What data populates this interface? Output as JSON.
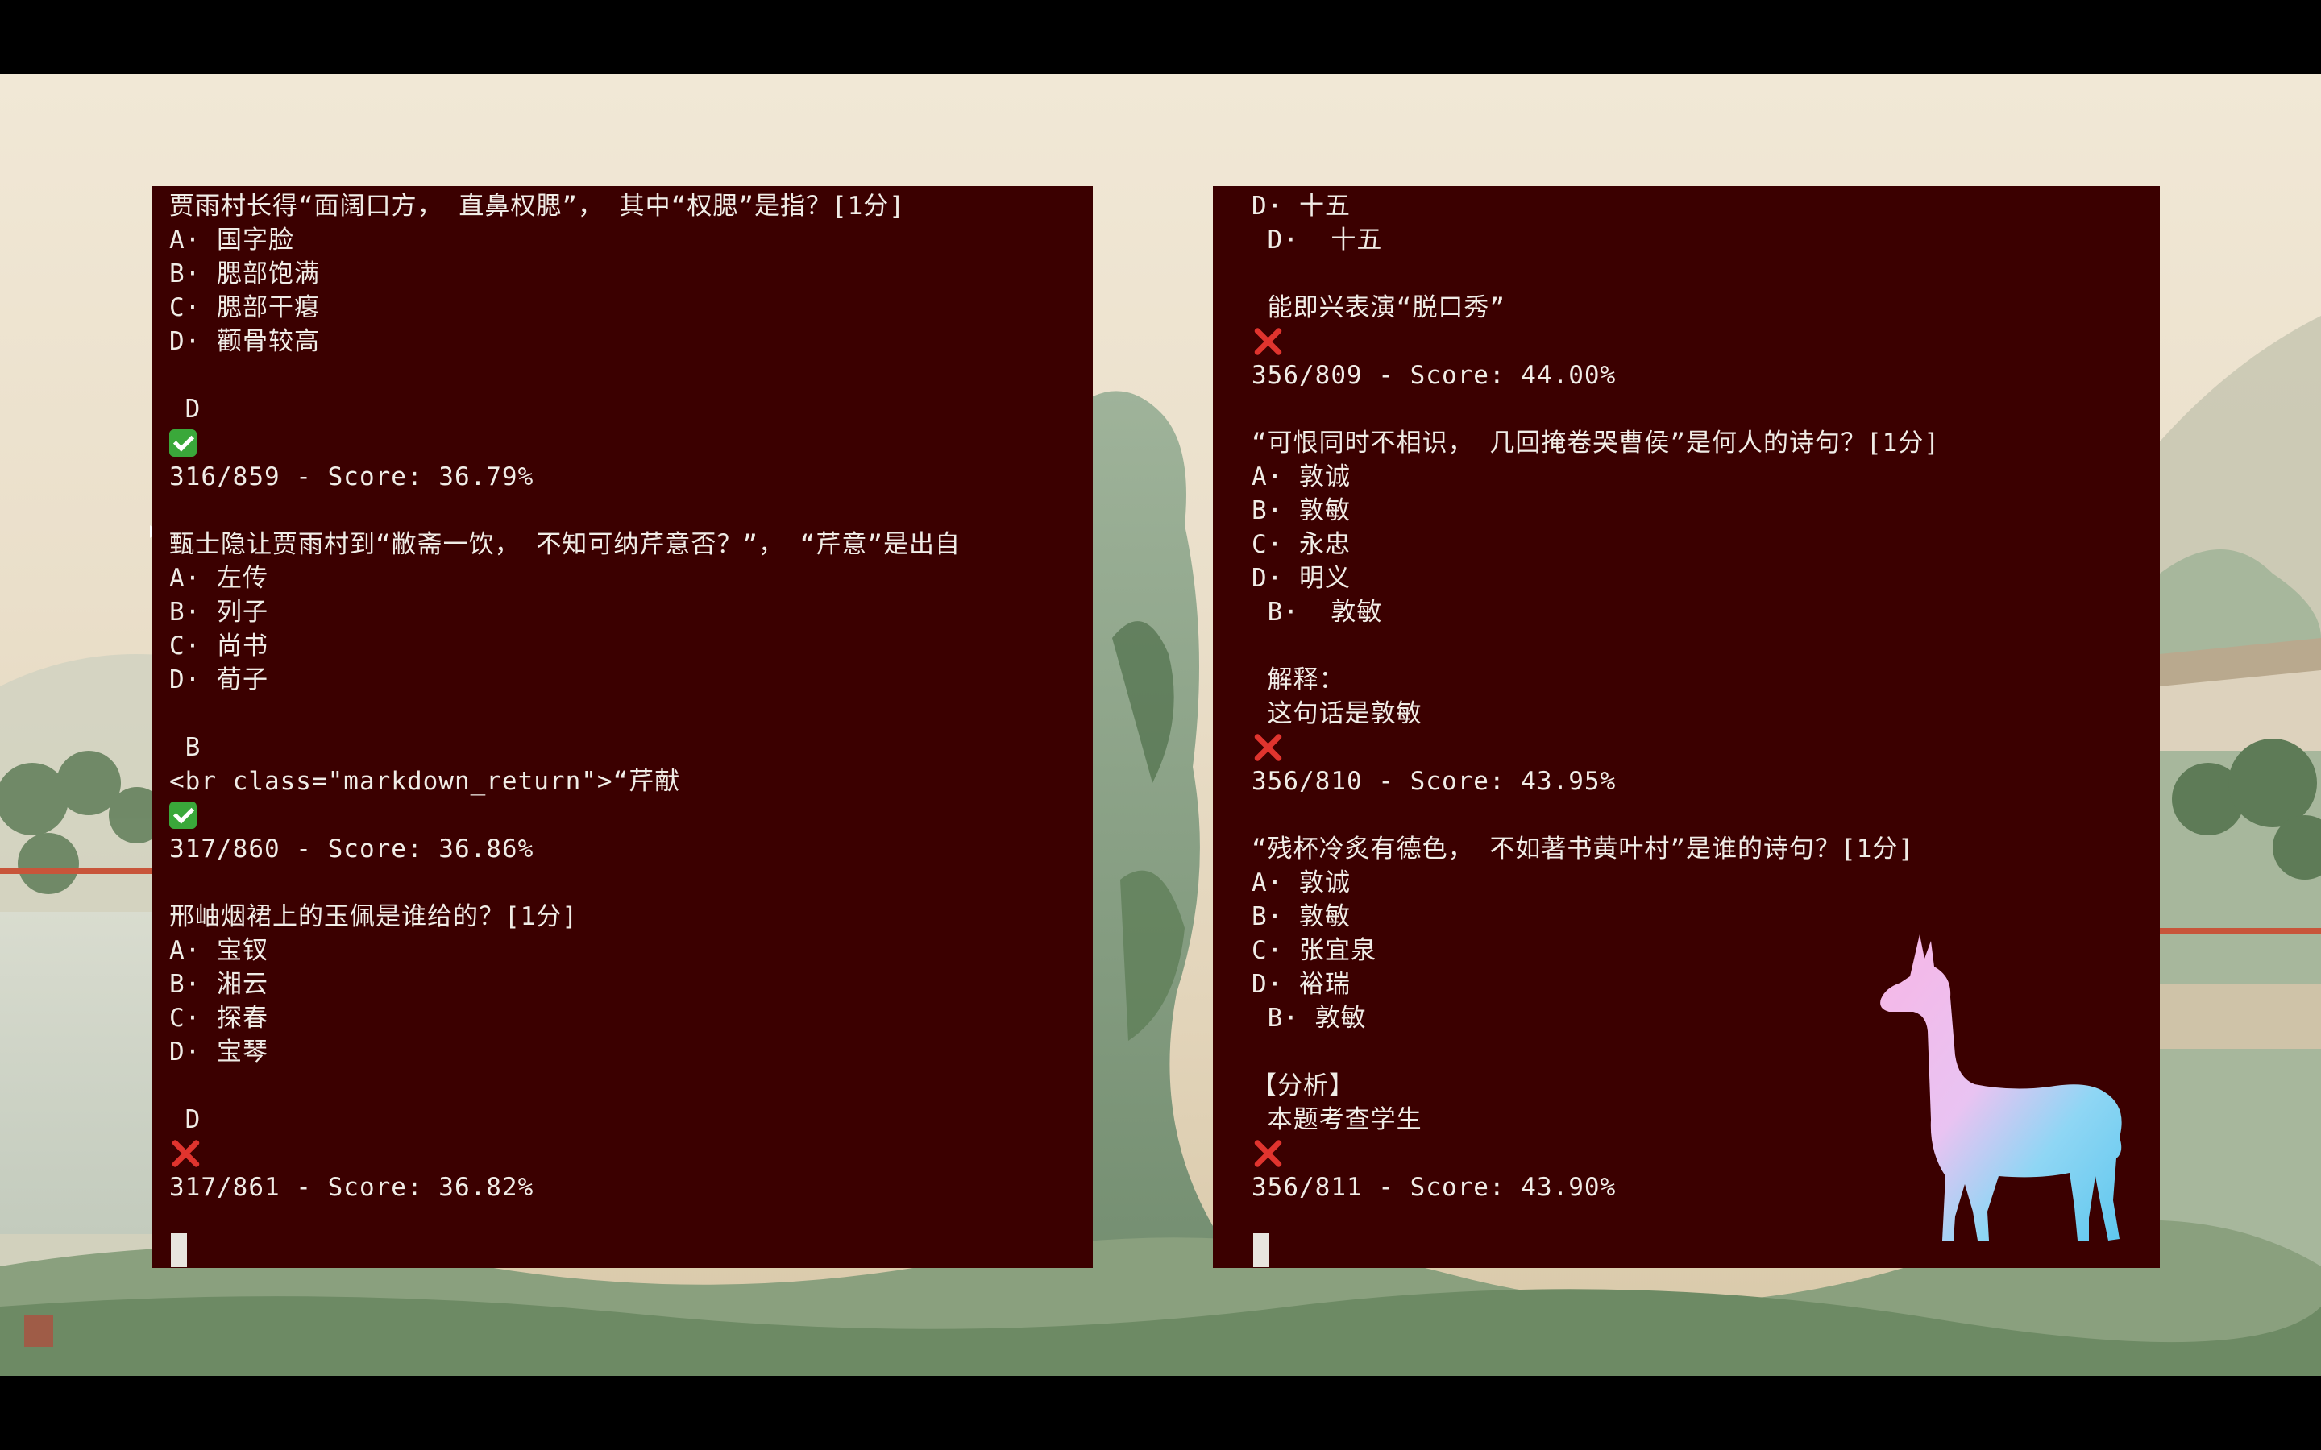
{
  "left_terminal": {
    "lines": [
      {
        "t": "贾雨村长得“面阔口方， 直鼻权腮”， 其中“权腮”是指？[1分]"
      },
      {
        "t": "A· 国字脸"
      },
      {
        "t": "B· 腮部饱满"
      },
      {
        "t": "C· 腮部干瘪"
      },
      {
        "t": "D· 颧骨较高"
      },
      {
        "t": ""
      },
      {
        "t": " D"
      },
      {
        "icon": "check"
      },
      {
        "t": "316/859 - Score: 36.79%"
      },
      {
        "t": ""
      },
      {
        "t": "甄士隐让贾雨村到“敝斋一饮， 不知可纳芹意否？”， “芹意”是出自"
      },
      {
        "t": "A· 左传"
      },
      {
        "t": "B· 列子"
      },
      {
        "t": "C· 尚书"
      },
      {
        "t": "D· 荀子"
      },
      {
        "t": ""
      },
      {
        "t": " B"
      },
      {
        "t": "<br class=\"markdown_return\">“芹献"
      },
      {
        "icon": "check"
      },
      {
        "t": "317/860 - Score: 36.86%"
      },
      {
        "t": ""
      },
      {
        "t": "邢岫烟裙上的玉佩是谁给的？[1分]"
      },
      {
        "t": "A· 宝钗"
      },
      {
        "t": "B· 湘云"
      },
      {
        "t": "C· 探春"
      },
      {
        "t": "D· 宝琴"
      },
      {
        "t": ""
      },
      {
        "t": " D"
      },
      {
        "icon": "cross"
      },
      {
        "t": "317/861 - Score: 36.82%"
      }
    ]
  },
  "right_terminal": {
    "lines": [
      {
        "t": "D· 十五"
      },
      {
        "t": " D·  十五"
      },
      {
        "t": ""
      },
      {
        "t": " 能即兴表演“脱口秀”"
      },
      {
        "icon": "cross"
      },
      {
        "t": "356/809 - Score: 44.00%"
      },
      {
        "t": ""
      },
      {
        "t": "“可恨同时不相识， 几回掩卷哭曹侯”是何人的诗句？[1分]"
      },
      {
        "t": "A· 敦诚"
      },
      {
        "t": "B· 敦敏"
      },
      {
        "t": "C· 永忠"
      },
      {
        "t": "D· 明义"
      },
      {
        "t": " B·  敦敏"
      },
      {
        "t": ""
      },
      {
        "t": " 解释："
      },
      {
        "t": " 这句话是敦敏"
      },
      {
        "icon": "cross"
      },
      {
        "t": "356/810 - Score: 43.95%"
      },
      {
        "t": ""
      },
      {
        "t": "“残杯冷炙有德色， 不如著书黄叶村”是谁的诗句？[1分]"
      },
      {
        "t": "A· 敦诚"
      },
      {
        "t": "B· 敦敏"
      },
      {
        "t": "C· 张宜泉"
      },
      {
        "t": "D· 裕瑞"
      },
      {
        "t": " B· 敦敏"
      },
      {
        "t": ""
      },
      {
        "t": "【分析】"
      },
      {
        "t": " 本题考查学生"
      },
      {
        "icon": "cross"
      },
      {
        "t": "356/811 - Score: 43.90%"
      }
    ]
  },
  "colors": {
    "terminal_bg": "#3b0000",
    "terminal_fg": "#f0ece6",
    "check": "#3aa83a",
    "cross": "#e0342e"
  },
  "icons": [
    "check-mark-icon",
    "cross-mark-icon",
    "llama-logo-icon",
    "terminal-cursor-icon"
  ]
}
